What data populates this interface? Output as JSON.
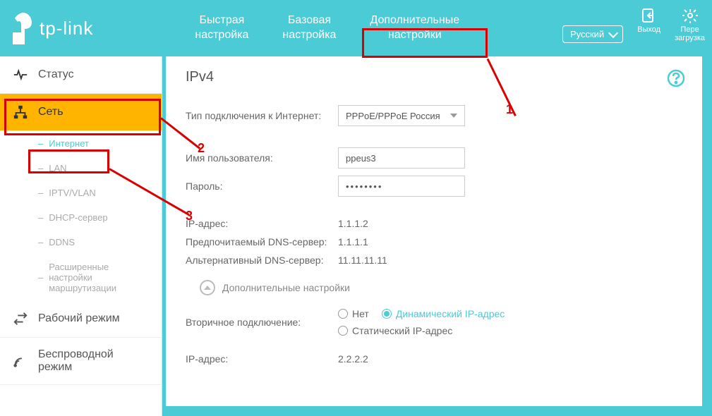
{
  "brand": "tp-link",
  "topnav": {
    "quick": "Быстрая\nнастройка",
    "basic": "Базовая\nнастройка",
    "advanced": "Дополнительные\nнастройки"
  },
  "header": {
    "language": "Русский",
    "logout": "Выход",
    "reboot": "Пере\nзагрузка"
  },
  "sidebar": {
    "status": "Статус",
    "network": "Сеть",
    "sub": {
      "internet": "Интернет",
      "lan": "LAN",
      "iptv": "IPTV/VLAN",
      "dhcp": "DHCP-сервер",
      "ddns": "DDNS",
      "routing": "Расширенные настройки маршрутизации"
    },
    "mode": "Рабочий режим",
    "wireless": "Беспроводной режим"
  },
  "form": {
    "title": "IPv4",
    "conn_type_label": "Тип подключения к Интернет:",
    "conn_type_value": "PPPoE/PPPoE Россия",
    "username_label": "Имя пользователя:",
    "username_value": "ppeus3",
    "password_label": "Пароль:",
    "password_value": "••••••••",
    "ip_label": "IP-адрес:",
    "ip_value": "1.1.1.2",
    "dns1_label": "Предпочитаемый DNS-сервер:",
    "dns1_value": "1.1.1.1",
    "dns2_label": "Альтернативный DNS-сервер:",
    "dns2_value": "11.11.11.11",
    "expand": "Дополнительные настройки",
    "secondary_label": "Вторичное подключение:",
    "sec_none": "Нет",
    "sec_dyn": "Динамический IP-адрес",
    "sec_static": "Статический IP-адрес",
    "ip2_label": "IP-адрес:",
    "ip2_value": "2.2.2.2"
  },
  "annotations": {
    "n1": "1",
    "n2": "2",
    "n3": "3"
  }
}
